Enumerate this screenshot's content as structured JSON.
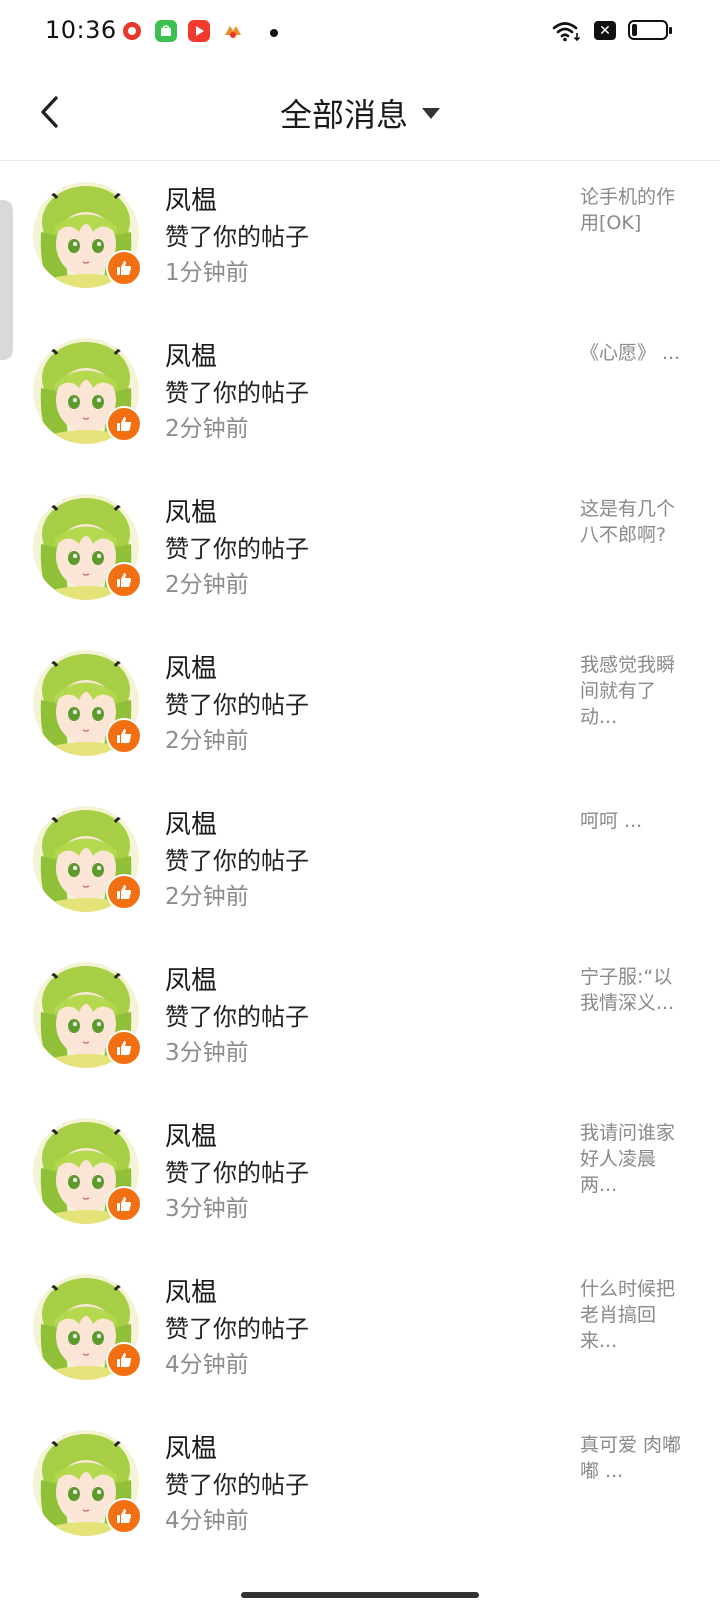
{
  "status_bar": {
    "time": "10:36",
    "app_icons": [
      "message-app-icon",
      "store-app-icon",
      "video-app-icon",
      "game-app-icon"
    ],
    "battery_level": 0.15
  },
  "header": {
    "back_icon": "chevron-left-icon",
    "title": "全部消息",
    "dropdown_icon": "caret-down-icon"
  },
  "notifications": [
    {
      "name": "凤榅",
      "action": "赞了你的帖子",
      "time": "1分钟前",
      "snippet": "论手机的作用[OK]"
    },
    {
      "name": "凤榅",
      "action": "赞了你的帖子",
      "time": "2分钟前",
      "snippet": "《心愿》 ..."
    },
    {
      "name": "凤榅",
      "action": "赞了你的帖子",
      "time": "2分钟前",
      "snippet": "这是有几个八不郎啊?"
    },
    {
      "name": "凤榅",
      "action": "赞了你的帖子",
      "time": "2分钟前",
      "snippet": "我感觉我瞬间就有了动..."
    },
    {
      "name": "凤榅",
      "action": "赞了你的帖子",
      "time": "2分钟前",
      "snippet": "呵呵 ..."
    },
    {
      "name": "凤榅",
      "action": "赞了你的帖子",
      "time": "3分钟前",
      "snippet": "宁子服:“以我情深义..."
    },
    {
      "name": "凤榅",
      "action": "赞了你的帖子",
      "time": "3分钟前",
      "snippet": "我请问谁家好人凌晨两..."
    },
    {
      "name": "凤榅",
      "action": "赞了你的帖子",
      "time": "4分钟前",
      "snippet": "什么时候把老肖搞回来..."
    },
    {
      "name": "凤榅",
      "action": "赞了你的帖子",
      "time": "4分钟前",
      "snippet": "真可爱 肉嘟嘟 ..."
    }
  ],
  "colors": {
    "like_badge": "#f27011",
    "secondary_text": "#8c8c8c",
    "avatar_hair": "#9bc53d"
  }
}
